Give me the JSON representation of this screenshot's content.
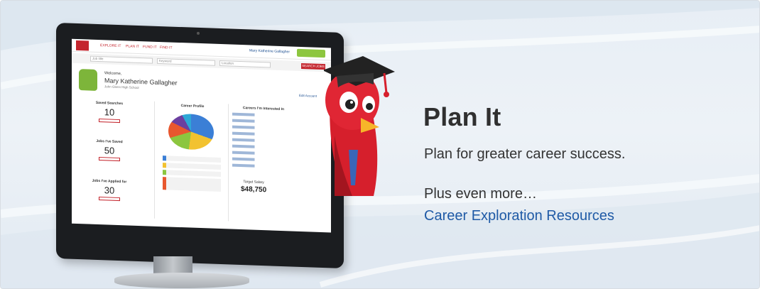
{
  "banner": {
    "title": "Plan It",
    "subtitle": "Plan for greater career success.",
    "more_text": "Plus even more…",
    "link_label": "Career Exploration Resources",
    "accent_color": "#1f5aa6",
    "title_color": "#303030"
  },
  "screen": {
    "nav_links": [
      "EXPLORE IT",
      "PLAN IT",
      "FUND IT",
      "FIND IT"
    ],
    "user_label": "Mary Katherine Gallagher",
    "search": {
      "keyword_placeholder": "Job title",
      "company_placeholder": "Keyword",
      "location_placeholder": "Location",
      "button_label": "SEARCH JOBS"
    },
    "welcome": "Welcome,",
    "name": "Mary Katherine Gallagher",
    "school": "John Glenn High School",
    "edit_label": "Edit Account",
    "stats": [
      {
        "label": "Saved Searches",
        "value": "10"
      },
      {
        "label": "Jobs I've Saved",
        "value": "50"
      },
      {
        "label": "Jobs I've Applied for",
        "value": "30"
      }
    ],
    "career_profile_label": "Career Profile",
    "careers_list_label": "Careers I'm Interested In",
    "salary_label": "Target Salary",
    "salary_value": "$48,750"
  }
}
